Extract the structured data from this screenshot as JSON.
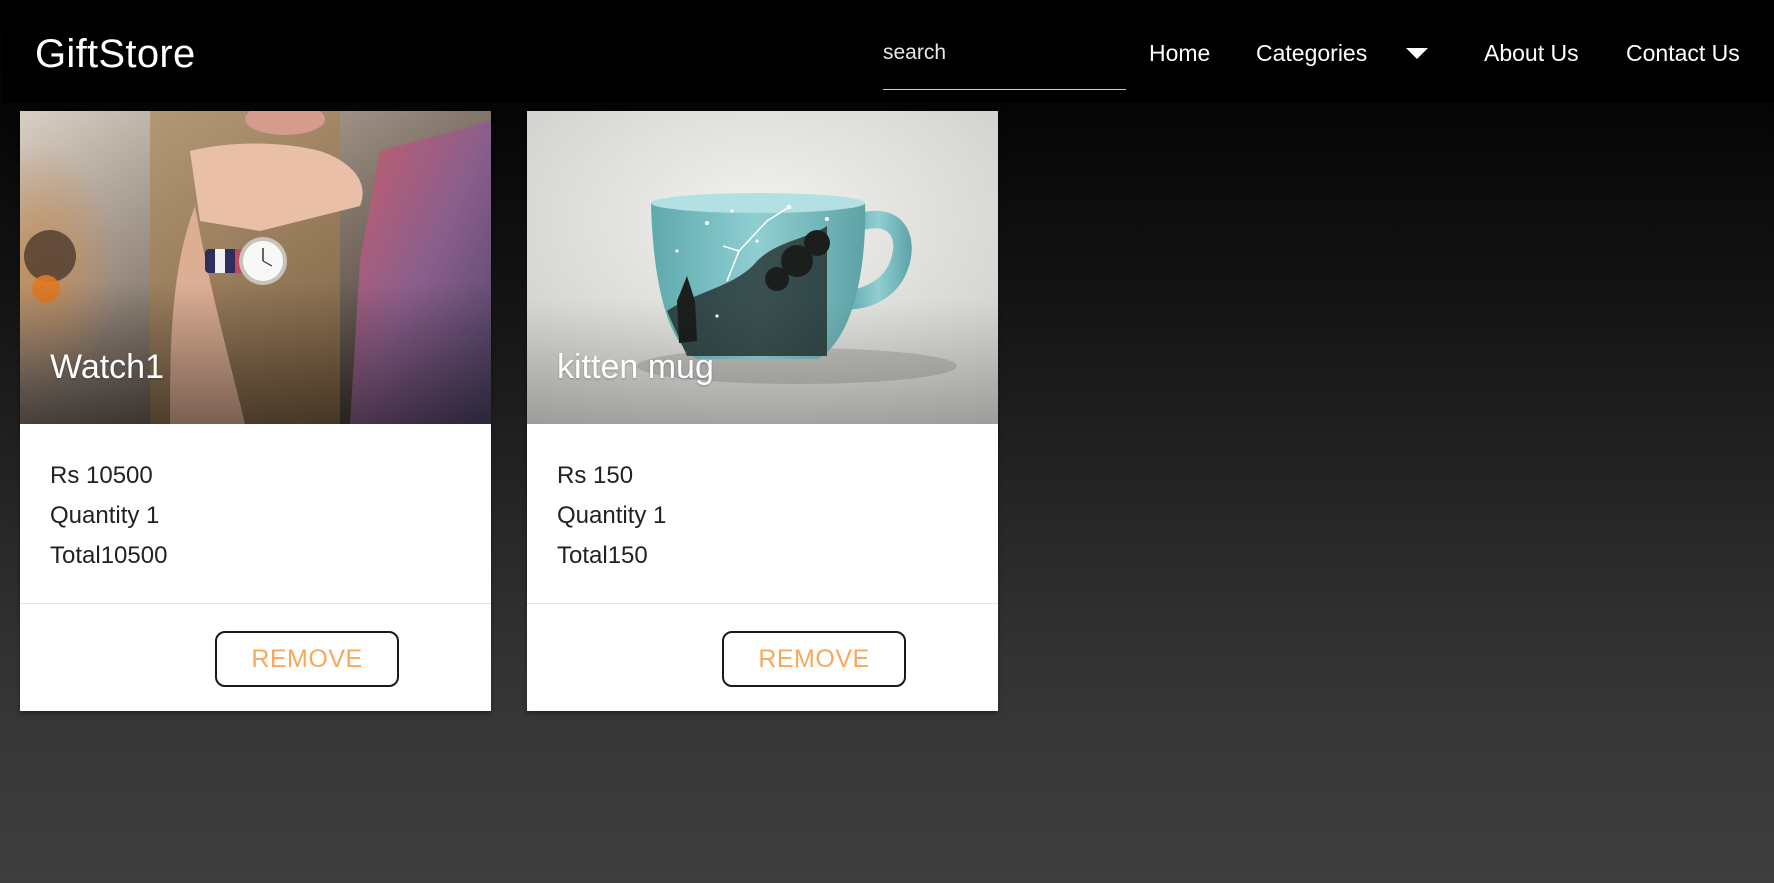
{
  "header": {
    "brand": "GiftStore",
    "search_placeholder": "search",
    "nav": {
      "home": "Home",
      "categories": "Categories",
      "about": "About Us",
      "contact": "Contact Us"
    }
  },
  "cart": {
    "items": [
      {
        "title": "Watch1",
        "price": "Rs 10500",
        "quantity": "Quantity 1",
        "total": "Total10500",
        "remove_label": "REMOVE"
      },
      {
        "title": "kitten mug",
        "price": "Rs 150",
        "quantity": "Quantity 1",
        "total": "Total150",
        "remove_label": "REMOVE"
      }
    ]
  },
  "colors": {
    "accent": "#f7a85a",
    "navbar": "#000000",
    "card": "#ffffff"
  },
  "icons": {
    "categories_toggle": "caret-down-icon"
  }
}
